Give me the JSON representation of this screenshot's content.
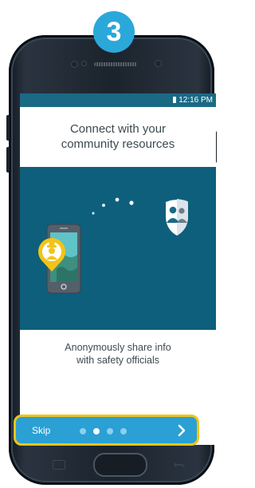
{
  "step_number": "3",
  "status_bar": {
    "time": "12:16 PM"
  },
  "onboarding": {
    "title_line1": "Connect with your",
    "title_line2": "community resources",
    "subtitle_line1": "Anonymously share info",
    "subtitle_line2": "with safety officials"
  },
  "navigation": {
    "skip_label": "Skip",
    "page_count": 4,
    "active_page": 2,
    "next_icon": "chevron-right-icon"
  },
  "colors": {
    "status_bar": "#1a6a86",
    "illustration_bg": "#0d5f7c",
    "nav_bar": "#2aa0d4",
    "highlight": "#f3c416",
    "step_badge": "#2aa8d9"
  }
}
